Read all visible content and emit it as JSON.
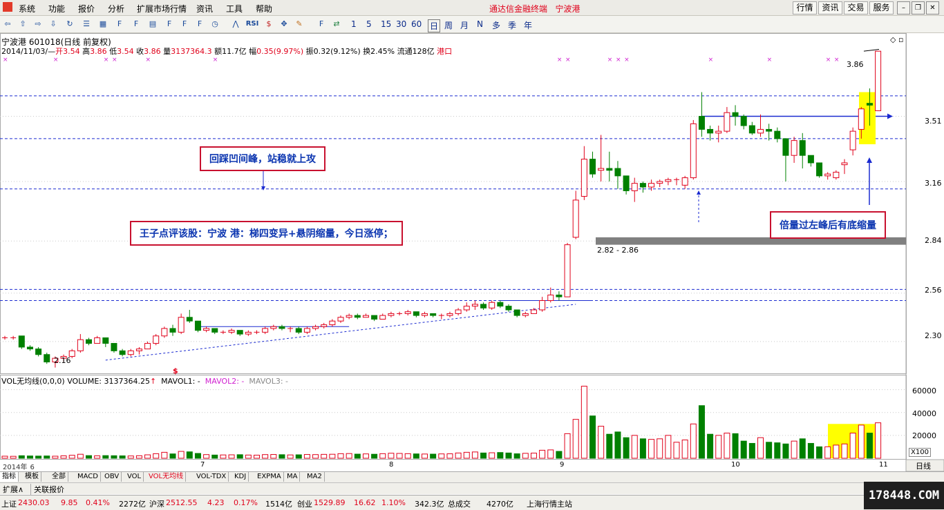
{
  "menu": [
    "系统",
    "功能",
    "报价",
    "分析",
    "扩展市场行情",
    "资讯",
    "工具",
    "帮助"
  ],
  "app_title": "通达信金融终端",
  "app_title_stock": "宁波港",
  "top_buttons": [
    "行情",
    "资讯",
    "交易",
    "服务"
  ],
  "toolbar_periods": [
    "1",
    "5",
    "15",
    "30",
    "60",
    "日",
    "周",
    "月",
    "N",
    "多",
    "季",
    "年"
  ],
  "stock": {
    "title": "宁波港 601018(日线 前复权)"
  },
  "quote": {
    "date": "2014/11/03/—",
    "open_label": "开",
    "open": "3.54",
    "high_label": "高",
    "high": "3.86",
    "low_label": "低",
    "low": "3.54",
    "close_label": "收",
    "close": "3.86",
    "vol_label": "量",
    "vol": "3137364.3",
    "amount": "额11.7亿",
    "change_label": "幅",
    "change": "0.35(9.97%)",
    "amp": "振0.32(9.12%)",
    "turnover": "换2.45%",
    "float": "流通128亿",
    "sector": "港口"
  },
  "annotations": {
    "a1": "回踩凹间峰，站稳就上攻",
    "a2": "王子点评该股：宁波 港：梯四变异+悬阴缩量，今日涨停；",
    "a3": "倍量过左峰后有底缩量"
  },
  "chart_labels": {
    "gap": "2.82 - 2.86",
    "low_mark": "2.16",
    "high_mark": "3.86"
  },
  "price_axis": [
    "3.51",
    "3.16",
    "2.84",
    "2.56",
    "2.30"
  ],
  "vol_axis": [
    "60000",
    "40000",
    "20000"
  ],
  "vol_unit": "X100",
  "period_label": "日线",
  "date_axis": [
    {
      "label": "2014年",
      "sub": "6"
    },
    {
      "label": "7"
    },
    {
      "label": "8"
    },
    {
      "label": "9"
    },
    {
      "label": "10"
    },
    {
      "label": "11"
    }
  ],
  "vol_legend": {
    "name": "VOL无均线(0,0,0)",
    "volume": "VOLUME: 3137364.25",
    "ma1": "MAVOL1: -",
    "ma2": "MAVOL2: -",
    "ma3": "MAVOL3: -"
  },
  "tabs": [
    "指标",
    "模板",
    "全部",
    "MACD",
    "OBV",
    "VOL",
    "VOL无均线",
    "VOL-TDX",
    "KDJ",
    "EXPMA",
    "MA",
    "MA2"
  ],
  "bottom_row": [
    "扩展∧",
    "关联报价"
  ],
  "status": {
    "sh_label": "上证",
    "sh_val": "2430.03",
    "sh_chg": "9.85",
    "sh_pct": "0.41%",
    "sh_amt": "2272亿",
    "sz_label": "沪深",
    "sz_val": "2512.55",
    "sz_chg": "4.23",
    "sz_pct": "0.17%",
    "sz_amt": "1514亿",
    "cy_label": "创业",
    "cy_val": "1529.89",
    "cy_chg": "16.62",
    "cy_pct": "1.10%",
    "cy_amt": "342.3亿",
    "total_label": "总成交",
    "total_amt": "4270亿",
    "server": "上海行情主站"
  },
  "watermark": "178448.COM",
  "colors": {
    "up": "#e0001a",
    "down": "#008000",
    "annot_border": "#c8102e",
    "annot_text": "#0b35b0",
    "highlight": "#ffff00"
  },
  "chart_data": {
    "type": "candlestick",
    "candles": [
      [
        2.32,
        2.33,
        2.31,
        2.32
      ],
      [
        2.32,
        2.33,
        2.31,
        2.32
      ],
      [
        2.33,
        2.33,
        2.26,
        2.27
      ],
      [
        2.27,
        2.28,
        2.25,
        2.26
      ],
      [
        2.26,
        2.27,
        2.22,
        2.23
      ],
      [
        2.23,
        2.24,
        2.18,
        2.19
      ],
      [
        2.19,
        2.22,
        2.16,
        2.21
      ],
      [
        2.21,
        2.23,
        2.19,
        2.22
      ],
      [
        2.22,
        2.26,
        2.21,
        2.25
      ],
      [
        2.25,
        2.34,
        2.24,
        2.31
      ],
      [
        2.31,
        2.32,
        2.28,
        2.29
      ],
      [
        2.29,
        2.33,
        2.29,
        2.32
      ],
      [
        2.32,
        2.32,
        2.27,
        2.29
      ],
      [
        2.29,
        2.29,
        2.24,
        2.25
      ],
      [
        2.25,
        2.26,
        2.22,
        2.23
      ],
      [
        2.23,
        2.26,
        2.22,
        2.25
      ],
      [
        2.25,
        2.27,
        2.23,
        2.26
      ],
      [
        2.26,
        2.3,
        2.26,
        2.29
      ],
      [
        2.29,
        2.34,
        2.28,
        2.33
      ],
      [
        2.33,
        2.38,
        2.32,
        2.37
      ],
      [
        2.37,
        2.39,
        2.33,
        2.35
      ],
      [
        2.35,
        2.45,
        2.34,
        2.43
      ],
      [
        2.43,
        2.47,
        2.4,
        2.41
      ],
      [
        2.41,
        2.41,
        2.35,
        2.36
      ],
      [
        2.36,
        2.38,
        2.35,
        2.37
      ],
      [
        2.37,
        2.37,
        2.34,
        2.35
      ],
      [
        2.35,
        2.36,
        2.34,
        2.35
      ],
      [
        2.35,
        2.37,
        2.34,
        2.36
      ],
      [
        2.36,
        2.36,
        2.33,
        2.34
      ],
      [
        2.34,
        2.36,
        2.33,
        2.35
      ],
      [
        2.35,
        2.36,
        2.34,
        2.35
      ],
      [
        2.35,
        2.38,
        2.34,
        2.37
      ],
      [
        2.37,
        2.39,
        2.36,
        2.38
      ],
      [
        2.38,
        2.39,
        2.36,
        2.37
      ],
      [
        2.37,
        2.38,
        2.35,
        2.37
      ],
      [
        2.37,
        2.38,
        2.34,
        2.35
      ],
      [
        2.35,
        2.38,
        2.34,
        2.37
      ],
      [
        2.37,
        2.39,
        2.36,
        2.38
      ],
      [
        2.38,
        2.4,
        2.37,
        2.39
      ],
      [
        2.39,
        2.42,
        2.38,
        2.41
      ],
      [
        2.41,
        2.44,
        2.4,
        2.43
      ],
      [
        2.43,
        2.45,
        2.42,
        2.44
      ],
      [
        2.44,
        2.45,
        2.42,
        2.43
      ],
      [
        2.43,
        2.45,
        2.43,
        2.44
      ],
      [
        2.44,
        2.44,
        2.41,
        2.42
      ],
      [
        2.42,
        2.45,
        2.42,
        2.44
      ],
      [
        2.44,
        2.46,
        2.43,
        2.45
      ],
      [
        2.45,
        2.46,
        2.44,
        2.45
      ],
      [
        2.45,
        2.47,
        2.44,
        2.46
      ],
      [
        2.46,
        2.46,
        2.43,
        2.44
      ],
      [
        2.44,
        2.46,
        2.43,
        2.45
      ],
      [
        2.45,
        2.45,
        2.43,
        2.44
      ],
      [
        2.44,
        2.45,
        2.42,
        2.44
      ],
      [
        2.44,
        2.46,
        2.43,
        2.45
      ],
      [
        2.45,
        2.48,
        2.44,
        2.47
      ],
      [
        2.47,
        2.51,
        2.46,
        2.49
      ],
      [
        2.49,
        2.52,
        2.47,
        2.5
      ],
      [
        2.5,
        2.51,
        2.47,
        2.48
      ],
      [
        2.48,
        2.52,
        2.47,
        2.51
      ],
      [
        2.51,
        2.52,
        2.48,
        2.49
      ],
      [
        2.49,
        2.5,
        2.46,
        2.47
      ],
      [
        2.47,
        2.47,
        2.43,
        2.44
      ],
      [
        2.44,
        2.46,
        2.43,
        2.45
      ],
      [
        2.45,
        2.48,
        2.45,
        2.47
      ],
      [
        2.47,
        2.54,
        2.46,
        2.52
      ],
      [
        2.52,
        2.59,
        2.51,
        2.55
      ],
      [
        2.55,
        2.57,
        2.52,
        2.54
      ],
      [
        2.54,
        2.83,
        2.54,
        2.82
      ],
      [
        2.86,
        3.11,
        2.85,
        3.06
      ],
      [
        3.08,
        3.35,
        3.06,
        3.28
      ],
      [
        3.28,
        3.32,
        3.18,
        3.2
      ],
      [
        3.22,
        3.41,
        3.16,
        3.23
      ],
      [
        3.23,
        3.32,
        3.16,
        3.22
      ],
      [
        3.23,
        3.27,
        3.12,
        3.19
      ],
      [
        3.19,
        3.19,
        3.09,
        3.11
      ],
      [
        3.11,
        3.18,
        3.05,
        3.15
      ],
      [
        3.15,
        3.16,
        3.1,
        3.13
      ],
      [
        3.13,
        3.17,
        3.11,
        3.15
      ],
      [
        3.15,
        3.17,
        3.13,
        3.16
      ],
      [
        3.16,
        3.18,
        3.14,
        3.17
      ],
      [
        3.17,
        3.18,
        3.14,
        3.17
      ],
      [
        3.14,
        3.19,
        3.12,
        3.18
      ],
      [
        3.18,
        3.49,
        3.17,
        3.47
      ],
      [
        3.51,
        3.64,
        3.4,
        3.44
      ],
      [
        3.44,
        3.46,
        3.38,
        3.42
      ],
      [
        3.42,
        3.46,
        3.37,
        3.43
      ],
      [
        3.43,
        3.56,
        3.42,
        3.53
      ],
      [
        3.53,
        3.57,
        3.46,
        3.51
      ],
      [
        3.51,
        3.52,
        3.44,
        3.46
      ],
      [
        3.46,
        3.48,
        3.41,
        3.42
      ],
      [
        3.42,
        3.52,
        3.4,
        3.44
      ],
      [
        3.44,
        3.47,
        3.38,
        3.43
      ],
      [
        3.43,
        3.45,
        3.37,
        3.39
      ],
      [
        3.39,
        3.39,
        3.16,
        3.3
      ],
      [
        3.3,
        3.4,
        3.26,
        3.38
      ],
      [
        3.38,
        3.42,
        3.23,
        3.3
      ],
      [
        3.3,
        3.3,
        3.24,
        3.26
      ],
      [
        3.26,
        3.26,
        3.18,
        3.19
      ],
      [
        3.19,
        3.21,
        3.17,
        3.2
      ],
      [
        3.18,
        3.22,
        3.17,
        3.21
      ],
      [
        3.25,
        3.28,
        3.2,
        3.26
      ],
      [
        3.33,
        3.45,
        3.3,
        3.43
      ],
      [
        3.44,
        3.56,
        3.39,
        3.55
      ],
      [
        3.58,
        3.66,
        3.46,
        3.57
      ],
      [
        3.54,
        3.86,
        3.54,
        3.86
      ]
    ],
    "volumes": [
      1800,
      1700,
      2200,
      2000,
      1900,
      2000,
      1800,
      2100,
      2600,
      3500,
      2300,
      2100,
      2300,
      2200,
      2100,
      2000,
      2200,
      3000,
      4000,
      5200,
      3800,
      6000,
      5600,
      4200,
      3200,
      2800,
      2900,
      3000,
      3100,
      2800,
      2700,
      3200,
      3300,
      3100,
      2900,
      3000,
      3300,
      3200,
      3400,
      3500,
      4000,
      4100,
      3600,
      3800,
      3500,
      4000,
      4400,
      4200,
      4000,
      3800,
      3700,
      3600,
      3800,
      3900,
      4600,
      5200,
      5500,
      4600,
      4800,
      5000,
      4600,
      3900,
      4300,
      4500,
      7000,
      7300,
      6000,
      21500,
      34000,
      63000,
      37000,
      28000,
      21000,
      23000,
      18000,
      20000,
      17000,
      16500,
      17000,
      20000,
      14000,
      16000,
      30000,
      46000,
      21000,
      20000,
      22000,
      21500,
      15000,
      13000,
      18000,
      14000,
      13500,
      12500,
      15000,
      17000,
      13000,
      10000,
      10000,
      11500,
      12500,
      22000,
      29000,
      22000,
      31000
    ],
    "ylim": [
      2.14,
      3.92
    ]
  }
}
